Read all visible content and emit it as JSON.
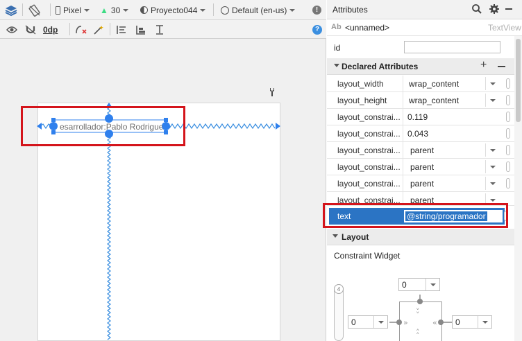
{
  "toolbar": {
    "device": "Pixel",
    "api_level": "30",
    "theme": "Proyecto044",
    "locale": "Default (en-us)",
    "margin": "0dp"
  },
  "canvas": {
    "textview_text": "esarrollador:Pablo Rodrigue"
  },
  "panel": {
    "title": "Attributes",
    "component_name": "<unnamed>",
    "component_type": "TextView",
    "id_label": "id",
    "id_value": "",
    "declared_title": "Declared Attributes",
    "attributes": [
      {
        "name": "layout_width",
        "value": "wrap_content"
      },
      {
        "name": "layout_height",
        "value": "wrap_content"
      },
      {
        "name": "layout_constrai...",
        "value": "0.119"
      },
      {
        "name": "layout_constrai...",
        "value": "0.043"
      },
      {
        "name": "layout_constrai...",
        "value": "parent"
      },
      {
        "name": "layout_constrai...",
        "value": "parent"
      },
      {
        "name": "layout_constrai...",
        "value": "parent"
      },
      {
        "name": "layout_constrai...",
        "value": "parent"
      }
    ],
    "text_attr": {
      "name": "text",
      "value": "@string/programador"
    },
    "layout_title": "Layout",
    "constraint_widget_label": "Constraint Widget",
    "margin_top": "0",
    "margin_left": "0",
    "margin_right": "0",
    "bias": "4"
  },
  "colors": {
    "accent": "#2f80ed",
    "highlight": "#d4141b",
    "selected_row": "#2b74c4"
  }
}
